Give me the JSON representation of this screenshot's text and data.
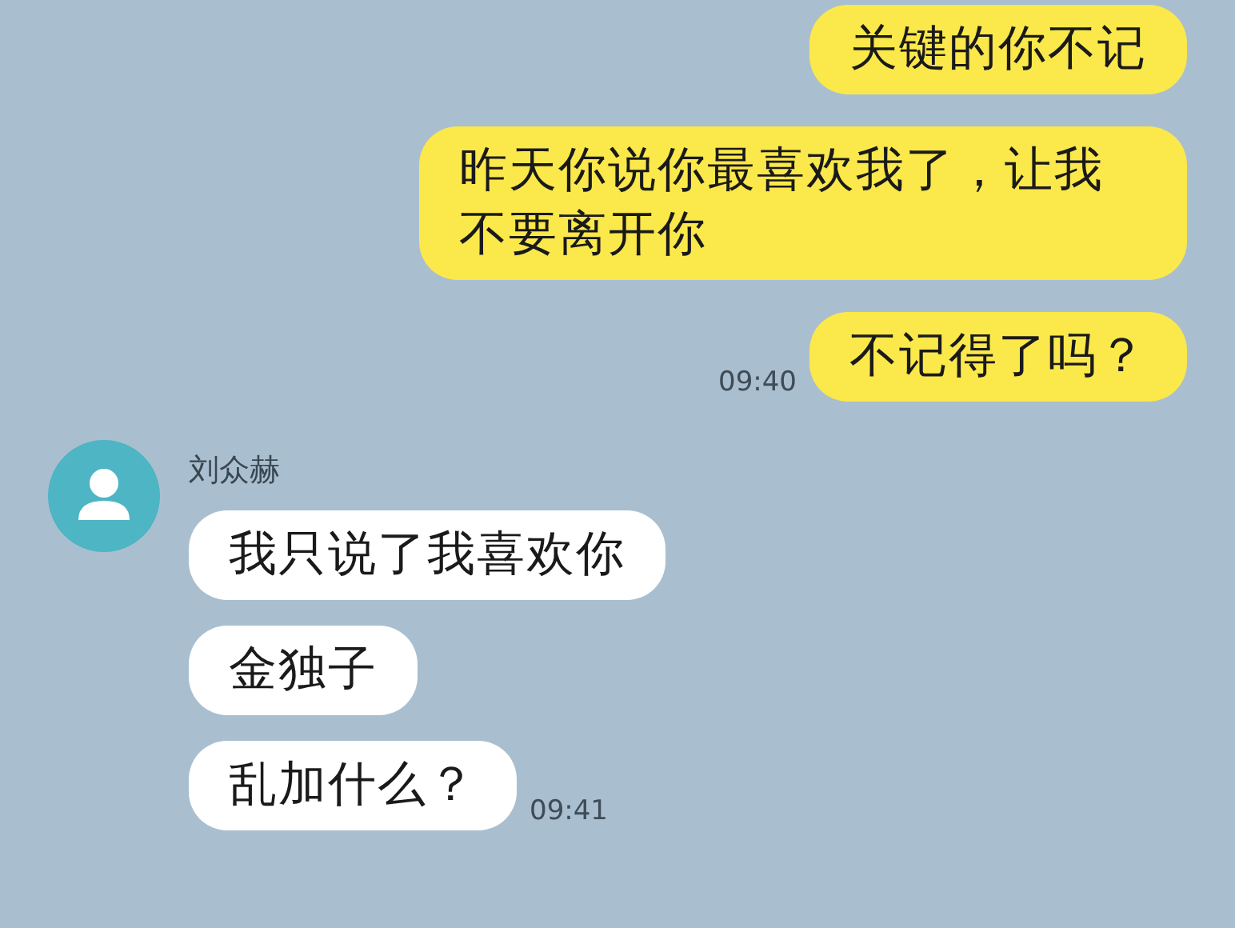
{
  "groups": [
    {
      "kind": "sent",
      "messages": [
        "关键的你不记",
        "昨天你说你最喜欢我了，让我不要离开你",
        "不记得了吗？"
      ],
      "time": "09:40"
    },
    {
      "kind": "received",
      "sender": "刘众赫",
      "messages": [
        "我只说了我喜欢你",
        "金独子",
        "乱加什么？"
      ],
      "time": "09:41"
    }
  ]
}
